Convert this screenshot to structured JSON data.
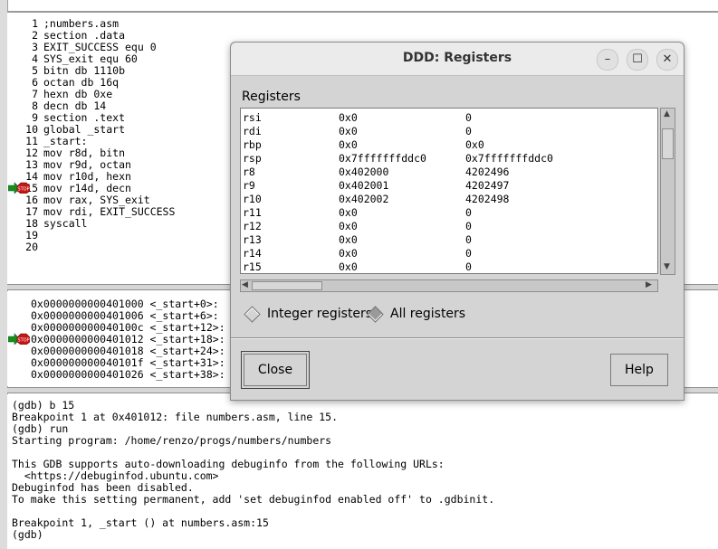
{
  "source": {
    "lines": [
      {
        "num": "1",
        "text": ";numbers.asm"
      },
      {
        "num": "2",
        "text": "section .data"
      },
      {
        "num": "3",
        "text": "EXIT_SUCCESS equ 0"
      },
      {
        "num": "4",
        "text": "SYS_exit equ 60"
      },
      {
        "num": "5",
        "text": "bitn db 1110b"
      },
      {
        "num": "6",
        "text": "octan db 16q"
      },
      {
        "num": "7",
        "text": "hexn db 0xe"
      },
      {
        "num": "8",
        "text": "decn db 14"
      },
      {
        "num": "9",
        "text": "section .text"
      },
      {
        "num": "10",
        "text": "global _start"
      },
      {
        "num": "11",
        "text": "_start:"
      },
      {
        "num": "12",
        "text": "mov r8d, bitn"
      },
      {
        "num": "13",
        "text": "mov r9d, octan"
      },
      {
        "num": "14",
        "text": "mov r10d, hexn"
      },
      {
        "num": "15",
        "text": "mov r14d, decn"
      },
      {
        "num": "16",
        "text": "mov rax, SYS_exit"
      },
      {
        "num": "17",
        "text": "mov rdi, EXIT_SUCCESS"
      },
      {
        "num": "18",
        "text": "syscall"
      },
      {
        "num": "19",
        "text": ""
      },
      {
        "num": "20",
        "text": ""
      }
    ],
    "marker_label": "STOP"
  },
  "machine": {
    "lines": [
      "0x0000000000401000 <_start+0>:",
      "0x0000000000401006 <_start+6>:",
      "0x000000000040100c <_start+12>:",
      "0x0000000000401012 <_start+18>:",
      "0x0000000000401018 <_start+24>:",
      "0x000000000040101f <_start+31>:",
      "0x0000000000401026 <_start+38>:"
    ]
  },
  "console": {
    "lines": [
      "(gdb) b 15",
      "Breakpoint 1 at 0x401012: file numbers.asm, line 15.",
      "(gdb) run",
      "Starting program: /home/renzo/progs/numbers/numbers",
      "",
      "This GDB supports auto-downloading debuginfo from the following URLs:",
      "  <https://debuginfod.ubuntu.com>",
      "Debuginfod has been disabled.",
      "To make this setting permanent, add 'set debuginfod enabled off' to .gdbinit.",
      "",
      "Breakpoint 1, _start () at numbers.asm:15",
      "(gdb)"
    ]
  },
  "dialog": {
    "title": "DDD: Registers",
    "minimize": "–",
    "maximize": "☐",
    "close": "✕",
    "section_label": "Registers",
    "registers": [
      {
        "name": "rsi",
        "hex": "0x0",
        "val": "0"
      },
      {
        "name": "rdi",
        "hex": "0x0",
        "val": "0"
      },
      {
        "name": "rbp",
        "hex": "0x0",
        "val": "0x0"
      },
      {
        "name": "rsp",
        "hex": "0x7fffffffddc0",
        "val": "0x7fffffffddc0"
      },
      {
        "name": "r8",
        "hex": "0x402000",
        "val": "4202496"
      },
      {
        "name": "r9",
        "hex": "0x402001",
        "val": "4202497"
      },
      {
        "name": "r10",
        "hex": "0x402002",
        "val": "4202498"
      },
      {
        "name": "r11",
        "hex": "0x0",
        "val": "0"
      },
      {
        "name": "r12",
        "hex": "0x0",
        "val": "0"
      },
      {
        "name": "r13",
        "hex": "0x0",
        "val": "0"
      },
      {
        "name": "r14",
        "hex": "0x0",
        "val": "0"
      },
      {
        "name": "r15",
        "hex": "0x0",
        "val": "0"
      }
    ],
    "radio_integer": "Integer registers",
    "radio_all": "All registers",
    "close_label": "Close",
    "help_label": "Help"
  }
}
